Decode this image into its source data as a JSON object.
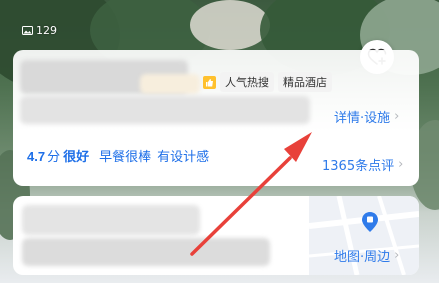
{
  "header": {
    "photo_count": "129"
  },
  "hotel_card": {
    "tags": [
      "人气热搜",
      "精品酒店"
    ],
    "details_link": "详情·设施",
    "rating": {
      "score": "4.7",
      "unit": "分",
      "level": "很好",
      "highlights": [
        "早餐很棒",
        "有设计感"
      ],
      "reviews": "1365条点评"
    }
  },
  "location_card": {
    "map_link": "地图·周边"
  },
  "colors": {
    "accent_blue": "#1e6fe8",
    "annotation_red": "#e8413a"
  }
}
